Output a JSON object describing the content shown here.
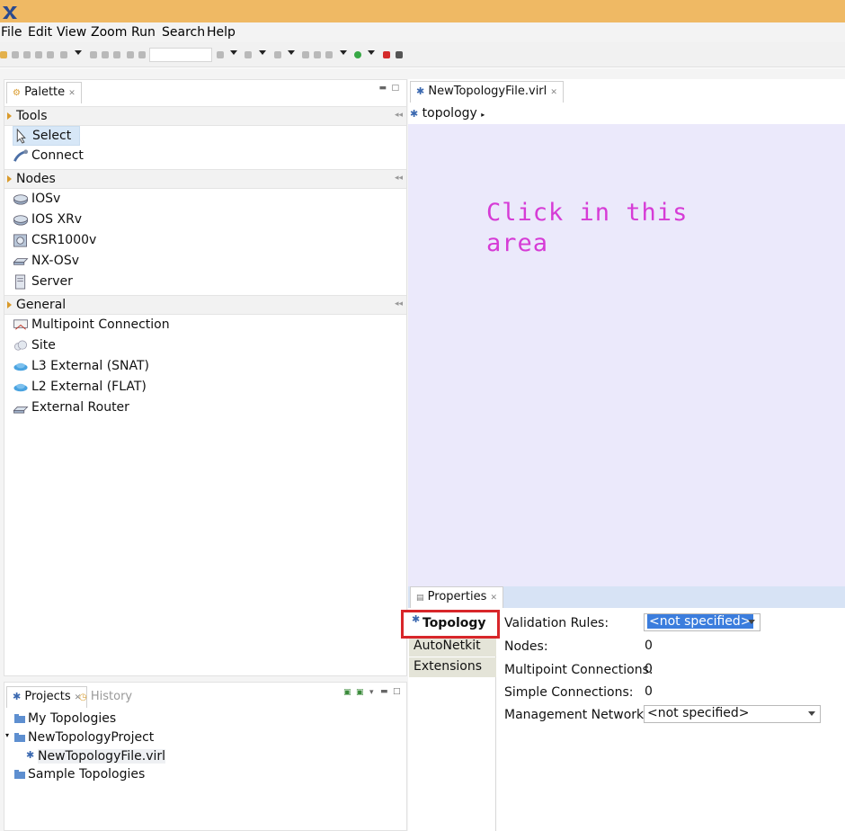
{
  "menu": [
    "File",
    "Edit",
    "View",
    "Zoom",
    "Run",
    "Search",
    "Help"
  ],
  "palette": {
    "tab_label": "Palette",
    "drawers": [
      {
        "label": "Tools",
        "items": [
          "Select",
          "Connect"
        ]
      },
      {
        "label": "Nodes",
        "items": [
          "IOSv",
          "IOS XRv",
          "CSR1000v",
          "NX-OSv",
          "Server"
        ]
      },
      {
        "label": "General",
        "items": [
          "Multipoint Connection",
          "Site",
          "L3 External (SNAT)",
          "L2 External (FLAT)",
          "External Router"
        ]
      }
    ]
  },
  "editor": {
    "tab_label": "NewTopologyFile.virl",
    "breadcrumb": "topology",
    "canvas_hint_line1": "Click in this",
    "canvas_hint_line2": "area"
  },
  "properties": {
    "tab_label": "Properties",
    "side_tabs": [
      "Topology",
      "AutoNetkit",
      "Extensions"
    ],
    "rows": [
      {
        "label": "Validation Rules:",
        "value": "<not specified>"
      },
      {
        "label": "Nodes:",
        "value": "0"
      },
      {
        "label": "Multipoint Connections:",
        "value": "0"
      },
      {
        "label": "Simple Connections:",
        "value": "0"
      },
      {
        "label": "Management Network:",
        "value": "<not specified>"
      }
    ]
  },
  "projects": {
    "tab_label": "Projects",
    "history_label": "History",
    "tree": [
      "My Topologies",
      "NewTopologyProject",
      "NewTopologyFile.virl",
      "Sample Topologies"
    ]
  },
  "colors": {
    "titlebar": "#efb964",
    "canvas": "#ebe9fb",
    "canvas_hint": "#d63cd6",
    "highlight_box": "#d8262a",
    "selection": "#3b7ddd"
  }
}
